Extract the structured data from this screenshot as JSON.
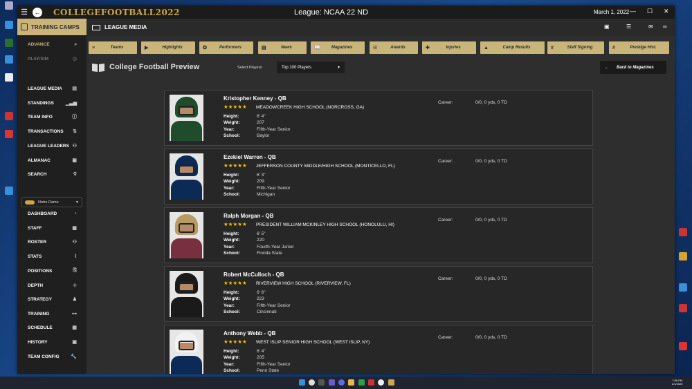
{
  "window": {
    "logo_text": "COLLEGEFOOTBALL2022",
    "league_title": "League: NCAA 22 ND",
    "date": "March 1, 2022",
    "minimize": "—",
    "maximize": "☐",
    "close": "✕"
  },
  "sidebar": {
    "section_title": "TRAINING CAMPS",
    "advance": "ADVANCE",
    "playsim": "PLAY/SIM",
    "group1": [
      "LEAGUE MEDIA",
      "STANDINGS",
      "TEAM INFO",
      "TRANSACTIONS",
      "LEAGUE LEADERS",
      "ALMANAC",
      "SEARCH"
    ],
    "team_select": "Notre Dame",
    "group2": [
      "DASHBOARD",
      "STAFF",
      "ROSTER",
      "STATS",
      "POSITIONS",
      "DEPTH",
      "STRATEGY",
      "TRAINING",
      "SCHEDULE",
      "HISTORY",
      "TEAM CONFIG"
    ]
  },
  "topbar": {
    "title": "LEAGUE MEDIA"
  },
  "tabs": [
    "Teams",
    "Highlights",
    "Performers",
    "News",
    "Magazines",
    "Awards",
    "Injuries",
    "Camp Results",
    "Staff Signing",
    "Prestige Hist."
  ],
  "header": {
    "title": "College Football Preview",
    "select_label": "Select Players:",
    "select_value": "Top 100 Players",
    "back_button": "Back to Magazines"
  },
  "labels": {
    "height": "Height:",
    "weight": "Weight:",
    "year": "Year:",
    "school": "School:",
    "career": "Career:"
  },
  "players": [
    {
      "name": "Kristopher Kenney - QB",
      "high_school": "MEADOWCREEK HIGH SCHOOL (NORCROSS, GA)",
      "height": "6' 4\"",
      "weight": "207",
      "year": "Fifth-Year Senior",
      "school": "Baylor",
      "career": "0/0, 0 yds, 0 TD",
      "helmet_color": "#1f4d2b",
      "jersey_color": "#1f4d2b",
      "stars": 5
    },
    {
      "name": "Ezekiel Warren - QB",
      "high_school": "JEFFERSON COUNTY MIDDLE/HIGH SCHOOL (MONTICELLO, FL)",
      "height": "6' 3\"",
      "weight": "209",
      "year": "Fifth-Year Senior",
      "school": "Michigan",
      "career": "0/0, 0 yds, 0 TD",
      "helmet_color": "#0b2a56",
      "jersey_color": "#0b2a56",
      "stars": 5
    },
    {
      "name": "Ralph Morgan - QB",
      "high_school": "PRESIDENT WILLIAM MCKINLEY HIGH SCHOOL (HONOLULU, HI)",
      "height": "6' 5\"",
      "weight": "220",
      "year": "Fourth-Year Junior",
      "school": "Florida State",
      "career": "0/0, 0 yds, 0 TD",
      "helmet_color": "#b79b62",
      "jersey_color": "#782f40",
      "stars": 5
    },
    {
      "name": "Robert McCulloch - QB",
      "high_school": "RIVERVIEW HIGH SCHOOL (RIVERVIEW, FL)",
      "height": "6' 6\"",
      "weight": "223",
      "year": "Fifth-Year Senior",
      "school": "Cincinnati",
      "career": "0/0, 0 yds, 0 TD",
      "helmet_color": "#1a1a1a",
      "jersey_color": "#1a1a1a",
      "stars": 5
    },
    {
      "name": "Anthony Webb - QB",
      "high_school": "WEST ISLIP SENIOR HIGH SCHOOL (WEST ISLIP, NY)",
      "height": "6' 4\"",
      "weight": "205",
      "year": "Fifth-Year Senior",
      "school": "Penn State",
      "career": "0/0, 0 yds, 0 TD",
      "helmet_color": "#f2f2f2",
      "jersey_color": "#0b2a56",
      "stars": 5
    }
  ],
  "taskbar": {
    "time": "7:56 PM",
    "date": "2/1/2022"
  }
}
